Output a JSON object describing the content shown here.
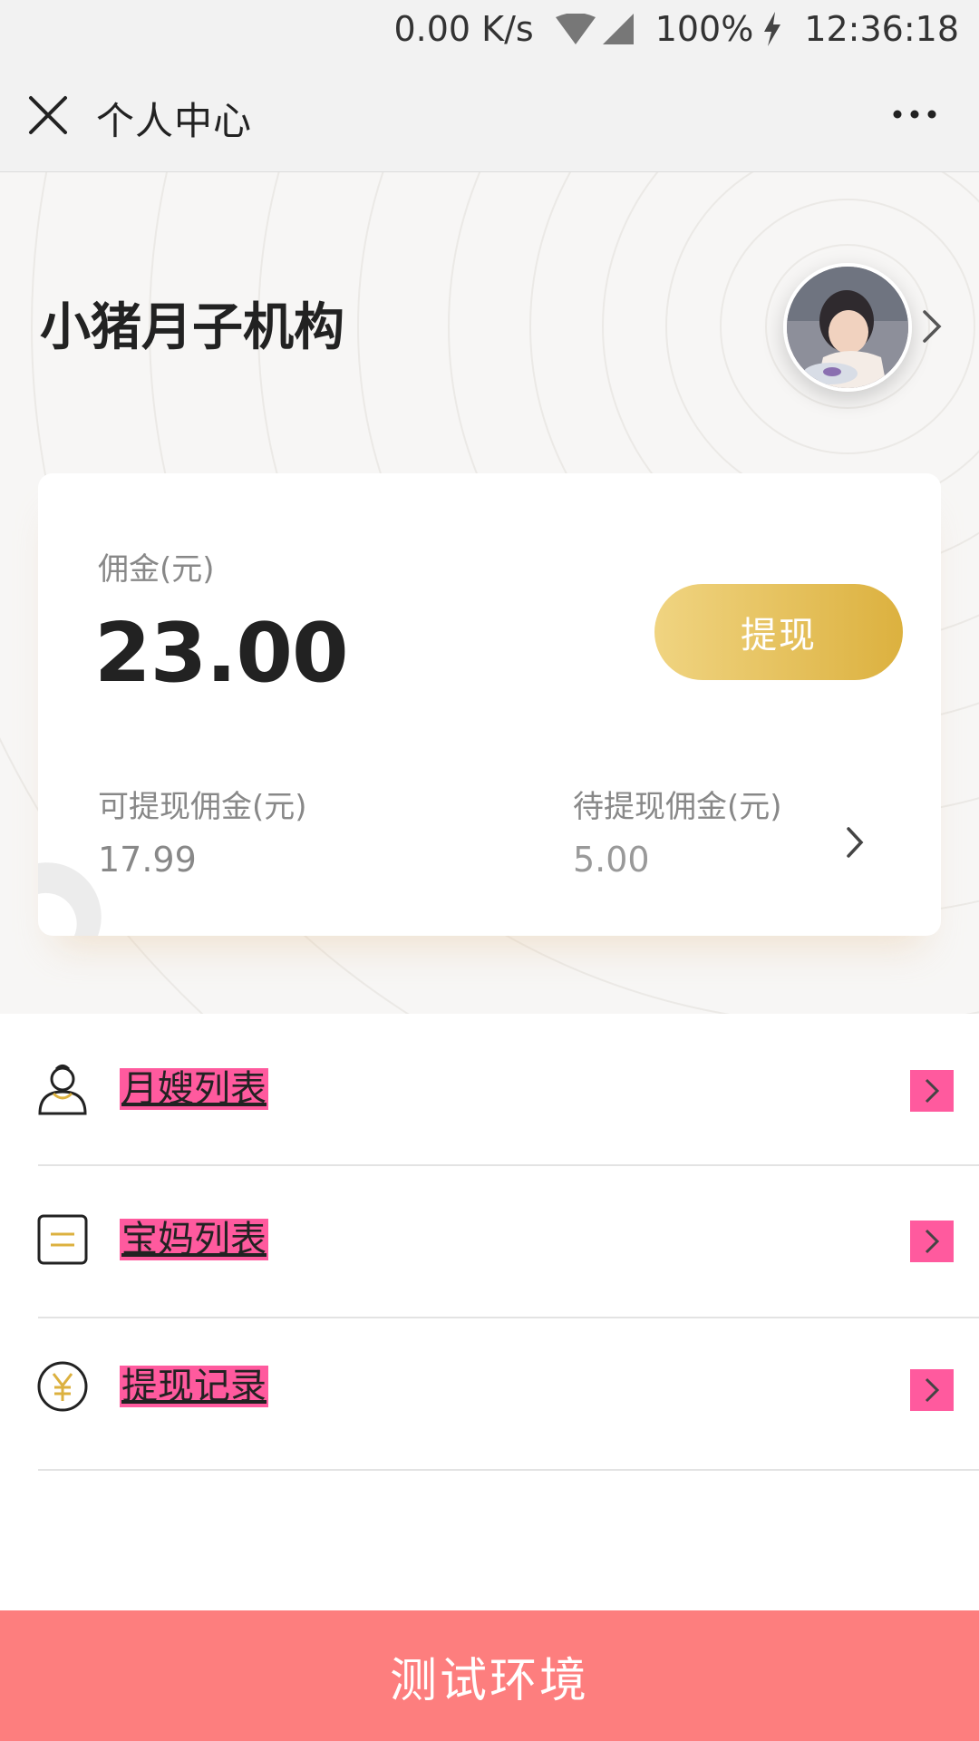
{
  "status_bar": {
    "net_speed": "0.00 K/s",
    "battery": "100%",
    "time": "12:36:18"
  },
  "nav": {
    "title": "个人中心"
  },
  "profile": {
    "org_name": "小猪月子机构"
  },
  "card": {
    "commission_label": "佣金(元)",
    "commission_value": "23.00",
    "withdraw_button": "提现",
    "available_label": "可提现佣金(元)",
    "available_value": "17.99",
    "pending_label": "待提现佣金(元)",
    "pending_value": "5.00"
  },
  "menu": {
    "items": [
      {
        "label": "月嫂列表",
        "icon": "nanny-icon"
      },
      {
        "label": "宝妈列表",
        "icon": "list-icon"
      },
      {
        "label": "提现记录",
        "icon": "yuan-coin-icon"
      }
    ]
  },
  "footer": {
    "label": "测试环境"
  },
  "colors": {
    "gold_start": "#f0d481",
    "gold_end": "#dcb13f",
    "footer_bg": "#fd7e7e",
    "highlight": "#ff5a9e"
  }
}
